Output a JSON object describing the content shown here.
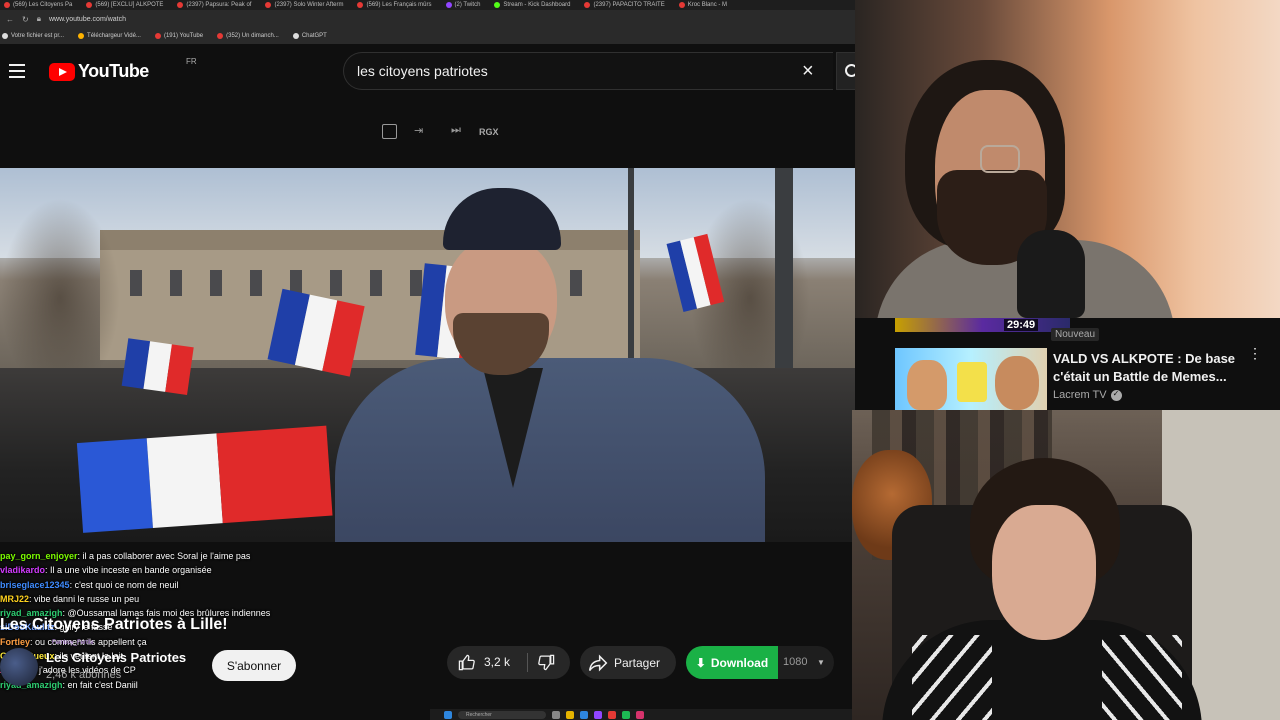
{
  "browser": {
    "tabs": [
      {
        "title": "(569) Les Citoyens Pa",
        "icon": "youtube-icon"
      },
      {
        "title": "(569) [EXCLU] ALKPOTE",
        "icon": "youtube-icon"
      },
      {
        "title": "(2397) Papsura: Peak of",
        "icon": "youtube-icon"
      },
      {
        "title": "(2397) Solo Winter Afterm",
        "icon": "youtube-icon"
      },
      {
        "title": "(569) Les Français mûrs",
        "icon": "youtube-icon"
      },
      {
        "title": "(2) Twitch",
        "icon": "twitch-icon"
      },
      {
        "title": "Stream - Kick Dashboard",
        "icon": "kick-icon"
      },
      {
        "title": "(2397) PAPACITO TRAITE",
        "icon": "youtube-icon"
      },
      {
        "title": "Kroc Blanc - M",
        "icon": "youtube-icon"
      }
    ],
    "address": "www.youtube.com/watch",
    "bookmarks": [
      "Votre fichier est pr...",
      "Téléchargeur Vidé...",
      "(191) YouTube",
      "(352) Un dimanch...",
      "ChatGPT"
    ]
  },
  "youtube": {
    "logo_text": "YouTube",
    "country_code": "FR",
    "search_value": "les citoyens patriotes",
    "clear_icon": "×",
    "extension_label": "RGX"
  },
  "chat": [
    {
      "user": "pay_gorn_enjoyer",
      "color": "#7cfc00",
      "message": "il a pas collaborer avec Soral je l'aime pas"
    },
    {
      "user": "vladikardo",
      "color": "#d23cff",
      "message": "Il a une vibe inceste en bande organisée"
    },
    {
      "user": "briseglace12345",
      "color": "#3f8cff",
      "message": "c'est quoi ce nom de neuil"
    },
    {
      "user": "MRJ22",
      "color": "#ffd21f",
      "message": "vibe danni le russe un peu"
    },
    {
      "user": "riyad_amazigh",
      "color": "#2ecc71",
      "message": "@Oussamal lamas fais moi des brûlures indiennes"
    },
    {
      "user": "siDooKaulitz",
      "color": "#7aa7ff",
      "message": "guiry le fasse"
    },
    {
      "user": "Fortley",
      "color": "#ff9f43",
      "message": "ou comment ils appellent ça"
    },
    {
      "user": "GrandGueux",
      "color": "#ffeb3b",
      "message": "ils veulent le lait"
    },
    {
      "user": "zanblog",
      "color": "#ff5fa2",
      "message": "j'adore les vidéos de CP"
    },
    {
      "user": "riyad_amazigh",
      "color": "#2ecc71",
      "message": "en fait c'est Daniil"
    }
  ],
  "chat_badge": "Femboy_Fertile",
  "video": {
    "title": "Les Citoyens Patriotes à Lille!",
    "channel": "Les Citoyens Patriotes",
    "subscribers": "2,46 k abonnés",
    "subscribe_label": "S'abonner",
    "like_count": "3,2 k",
    "share_label": "Partager",
    "download_label": "Download",
    "download_quality": "1080"
  },
  "recommendation": {
    "duration": "29:49",
    "badge": "Nouveau",
    "title": "VALD VS ALKPOTE : De base c'était un Battle de Memes...",
    "channel": "Lacrem TV",
    "more_icon": "⋮"
  },
  "taskbar": {
    "search_label": "Rechercher"
  },
  "colors": {
    "youtube_red": "#ff0000",
    "download_green": "#1ab146",
    "background": "#0f0f0f"
  }
}
